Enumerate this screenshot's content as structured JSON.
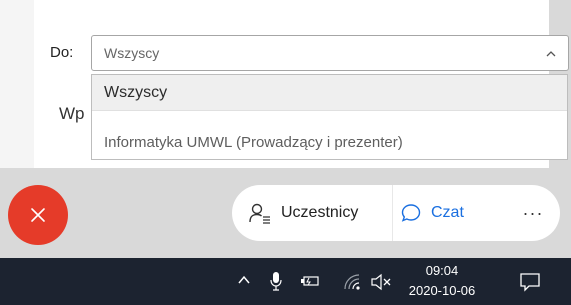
{
  "filter": {
    "label": "Do:",
    "selected": "Wszyscy"
  },
  "chat_fragment": "Wp",
  "dropdown": {
    "options": [
      "Wszyscy",
      "Informatyka UMWL (Prowadzący i prezenter)"
    ]
  },
  "toolbar": {
    "participants_label": "Uczestnicy",
    "chat_label": "Czat",
    "more_label": "···"
  },
  "taskbar": {
    "time": "09:04",
    "date": "2020-10-06"
  },
  "colors": {
    "end_call": "#e53b29",
    "chat_accent": "#1a6fe0",
    "taskbar": "#1c2330"
  }
}
